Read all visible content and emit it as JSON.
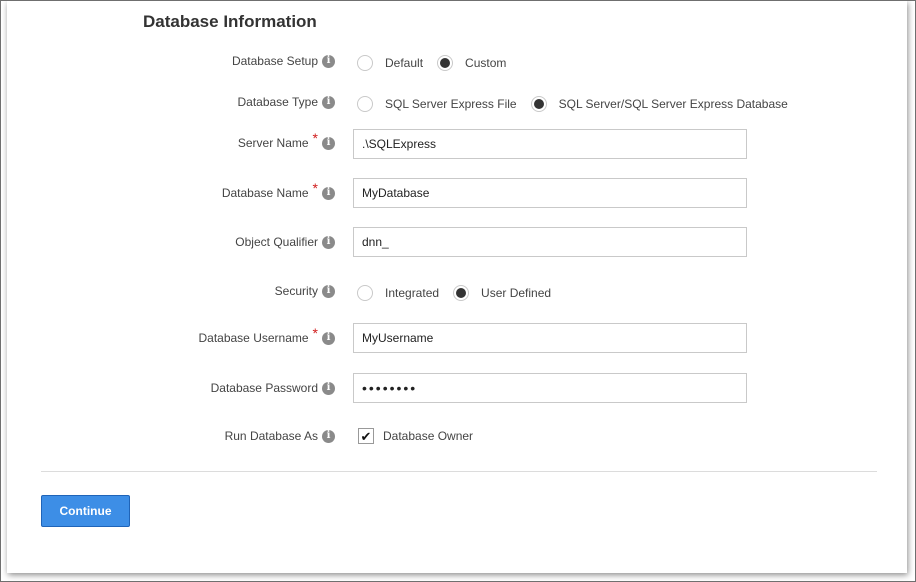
{
  "section": {
    "title": "Database Information"
  },
  "info_icon_glyph": "i",
  "fields": {
    "database_setup": {
      "label": "Database Setup",
      "options": [
        "Default",
        "Custom"
      ],
      "selected": "Custom"
    },
    "database_type": {
      "label": "Database Type",
      "options": [
        "SQL Server Express File",
        "SQL Server/SQL Server Express Database"
      ],
      "selected": "SQL Server/SQL Server Express Database"
    },
    "server_name": {
      "label": "Server Name",
      "value": ".\\SQLExpress"
    },
    "database_name": {
      "label": "Database Name",
      "value": "MyDatabase"
    },
    "object_qualifier": {
      "label": "Object Qualifier",
      "value": "dnn_"
    },
    "security": {
      "label": "Security",
      "options": [
        "Integrated",
        "User Defined"
      ],
      "selected": "User Defined"
    },
    "database_username": {
      "label": "Database Username",
      "value": "MyUsername"
    },
    "database_password": {
      "label": "Database Password",
      "value": "••••••••"
    },
    "run_database_as": {
      "label": "Run Database As",
      "checkbox_label": "Database Owner",
      "checked": true
    }
  },
  "required_marker": "*",
  "actions": {
    "continue_label": "Continue"
  },
  "colors": {
    "accent": "#3d8ee6",
    "required": "#d01c1c",
    "info_icon": "#8a8a8a"
  }
}
